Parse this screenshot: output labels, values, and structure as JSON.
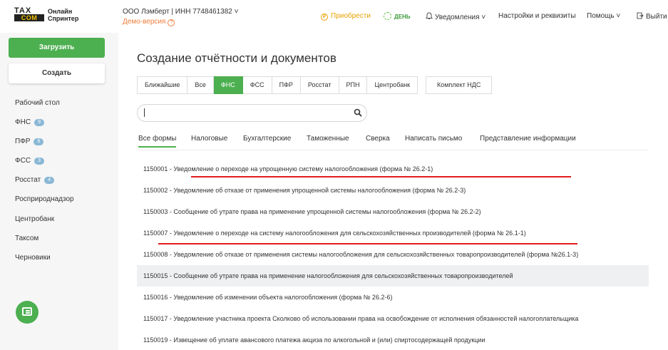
{
  "header": {
    "logo_tax": "TAX",
    "logo_com": "COM",
    "logo_line1": "Онлайн",
    "logo_line2": "Спринтер",
    "company": "ООО Лэмберт | ИНН 7748461382",
    "company_chevron": "˅",
    "demo": "Демо-версия",
    "demo_q": "?",
    "buy": "Приобрести",
    "buy_symbol": "₽",
    "day": "ДЕНЬ",
    "notifications": "Уведомления",
    "settings": "Настройки и реквизиты",
    "help": "Помощь",
    "logout": "Выйти",
    "chevron": "˅"
  },
  "sidebar": {
    "upload": "Загрузить",
    "create": "Создать",
    "items": [
      {
        "label": "Рабочий стол",
        "badge": ""
      },
      {
        "label": "ФНС",
        "badge": "9"
      },
      {
        "label": "ПФР",
        "badge": "6"
      },
      {
        "label": "ФСС",
        "badge": "3"
      },
      {
        "label": "Росстат",
        "badge": "4"
      },
      {
        "label": "Росприроднадзор",
        "badge": ""
      },
      {
        "label": "Центробанк",
        "badge": ""
      },
      {
        "label": "Таксом",
        "badge": ""
      },
      {
        "label": "Черновики",
        "badge": ""
      }
    ]
  },
  "main": {
    "title": "Создание отчётности и документов",
    "tabs": [
      "Ближайшие",
      "Все",
      "ФНС",
      "ФСС",
      "ПФР",
      "Росстат",
      "РПН",
      "Центробанк"
    ],
    "active_tab": "ФНС",
    "vat_tab": "Комплект НДС",
    "search_value": "",
    "subtabs": [
      "Все формы",
      "Налоговые",
      "Бухгалтерские",
      "Таможенные",
      "Сверка",
      "Написать письмо",
      "Представление информации"
    ],
    "rows": [
      "1150001 - Уведомление о переходе на упрощенную систему налогообложения (форма № 26.2-1)",
      "1150002 - Уведомление об отказе от применения упрощенной системы налогообложения (форма № 26.2-3)",
      "1150003 - Сообщение об утрате права на применение упрощенной системы налогообложения (форма № 26.2-2)",
      "1150007 - Уведомление о переходе на систему налогообложения для сельскохозяйственных производителей (форма № 26.1-1)",
      "1150008 - Уведомление об отказе от применения системы налогообложения для сельскохозяйственных товаропроизводителей (форма №26.1-3)",
      "1150015 - Сообщение об утрате права на применение налогообложения для сельскохозяйственных товаропроизводителей",
      "1150016 - Уведомление об изменении объекта налогообложения (форма № 26.2-6)",
      "1150017 - Уведомление участника проекта Сколково об использовании права на освобождение от исполнения обязанностей налогоплательщика",
      "1150019 - Извещение об уплате авансового платежа акциза по алкогольной и (или) спиртосодержащей продукции"
    ]
  },
  "colors": {
    "accent": "#4caf50",
    "demo": "#f07f3c",
    "underline": "#e31b1b",
    "badge": "#8ab8d6"
  }
}
